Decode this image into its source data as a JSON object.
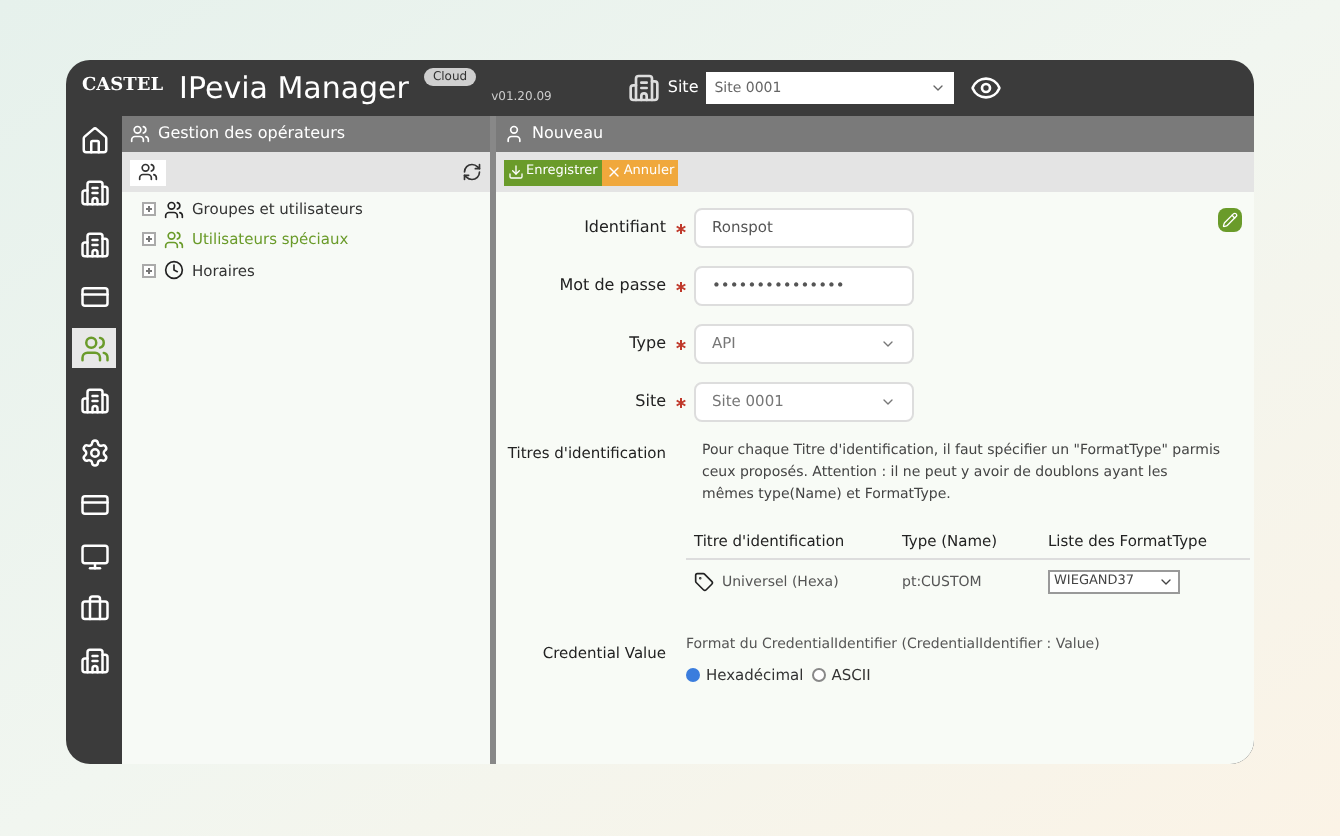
{
  "header": {
    "logo": "CASTEL",
    "title": "IPevia Manager",
    "badge": "Cloud",
    "version": "v01.20.09",
    "site_label": "Site",
    "site_select": "Site 0001"
  },
  "sidebar": {
    "items": [
      {
        "kind": "home",
        "selected": false
      },
      {
        "kind": "site-add",
        "selected": false
      },
      {
        "kind": "site-user",
        "selected": false
      },
      {
        "kind": "badge",
        "selected": false
      },
      {
        "kind": "users",
        "selected": true
      },
      {
        "kind": "site-edit",
        "selected": false
      },
      {
        "kind": "gears",
        "selected": false
      },
      {
        "kind": "badge",
        "selected": false
      },
      {
        "kind": "monitor",
        "selected": false
      },
      {
        "kind": "toolbox",
        "selected": false
      },
      {
        "kind": "site-list",
        "selected": false
      }
    ]
  },
  "left_panel": {
    "title": "Gestion des opérateurs",
    "tree": [
      {
        "label": "Groupes et utilisateurs",
        "kind": "group",
        "selected": false
      },
      {
        "label": "Utilisateurs spéciaux",
        "kind": "group",
        "selected": true
      },
      {
        "label": "Horaires",
        "kind": "clock",
        "selected": false
      }
    ]
  },
  "right_panel": {
    "title": "Nouveau",
    "buttons": [
      {
        "label": "Enregistrer",
        "kind": "save"
      },
      {
        "label": "Annuler",
        "kind": "cancel"
      }
    ],
    "fields": [
      {
        "label": "Identifiant",
        "kind": "text",
        "required": true,
        "value": "Ronspot"
      },
      {
        "label": "Mot de passe",
        "kind": "password",
        "required": true,
        "value": "•••••••••••••••"
      },
      {
        "label": "Type",
        "kind": "select",
        "required": true,
        "value": "API"
      },
      {
        "label": "Site",
        "kind": "select",
        "required": true,
        "value": "Site 0001"
      }
    ],
    "titles": {
      "label": "Titres d'identification",
      "description": "Pour chaque Titre d'identification, il faut spécifier un \"FormatType\" parmis ceux proposés. Attention : il ne peut y avoir de doublons ayant les mêmes type(Name) et FormatType.",
      "columns": [
        "Titre d'identification",
        "Type (Name)",
        "Liste des FormatType"
      ],
      "rows": [
        {
          "title": "Universel (Hexa)",
          "type": "pt:CUSTOM",
          "format": "WIEGAND37"
        }
      ]
    },
    "credential": {
      "label": "Credential Value",
      "description": "Format du CredentialIdentifier (CredentialIdentifier : Value)",
      "options": [
        {
          "label": "Hexadécimal",
          "selected": true
        },
        {
          "label": "ASCII",
          "selected": false
        }
      ]
    }
  }
}
